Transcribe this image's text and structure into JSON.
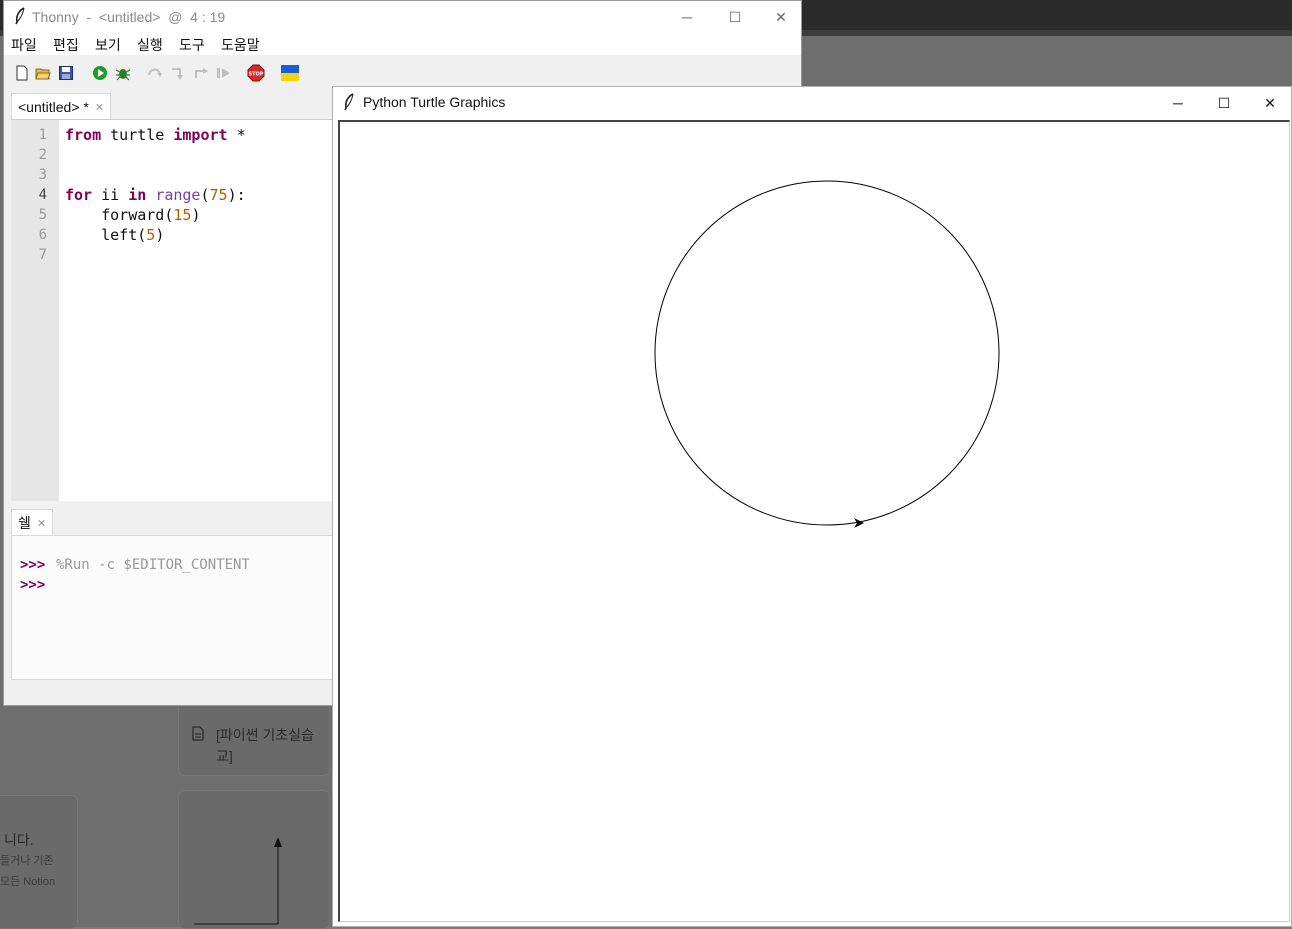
{
  "background": {
    "doc_item": "[파이썬 기초실습",
    "doc_item_cont": "교]",
    "side_text_1": "니다.",
    "side_text_2": "들거나 기존",
    "side_text_3": "모든 Notion"
  },
  "thonny": {
    "title": "Thonny  -  <untitled>  @  4 : 19",
    "menu": [
      "파일",
      "편집",
      "보기",
      "실행",
      "도구",
      "도움말"
    ],
    "editor_tab": "<untitled> *",
    "line_numbers": [
      "1",
      "2",
      "3",
      "4",
      "5",
      "6",
      "7"
    ],
    "code": {
      "l1_kw1": "from",
      "l1_mod": " turtle ",
      "l1_kw2": "import",
      "l1_rest": " *",
      "l4_kw1": "for",
      "l4_var": " ii ",
      "l4_kw2": "in",
      "l4_sp": " ",
      "l4_fn": "range",
      "l4_open": "(",
      "l4_num": "75",
      "l4_close": "):",
      "l5_fn": "    forward(",
      "l5_num": "15",
      "l5_close": ")",
      "l6_fn": "    left(",
      "l6_num": "5",
      "l6_close": ")"
    },
    "shell_tab": "쉘",
    "shell_prompt_1": ">>>",
    "shell_cmd": "%Run -c $EDITOR_CONTENT",
    "shell_prompt_2": ">>>"
  },
  "turtle_window": {
    "title": "Python Turtle Graphics"
  },
  "icons": [
    "feather-icon",
    "new-file-icon",
    "open-file-icon",
    "save-icon",
    "run-icon",
    "debug-icon",
    "step-over-icon",
    "step-into-icon",
    "step-out-icon",
    "resume-icon",
    "stop-icon",
    "ukraine-flag-icon",
    "minimize-icon",
    "maximize-icon",
    "close-icon"
  ]
}
